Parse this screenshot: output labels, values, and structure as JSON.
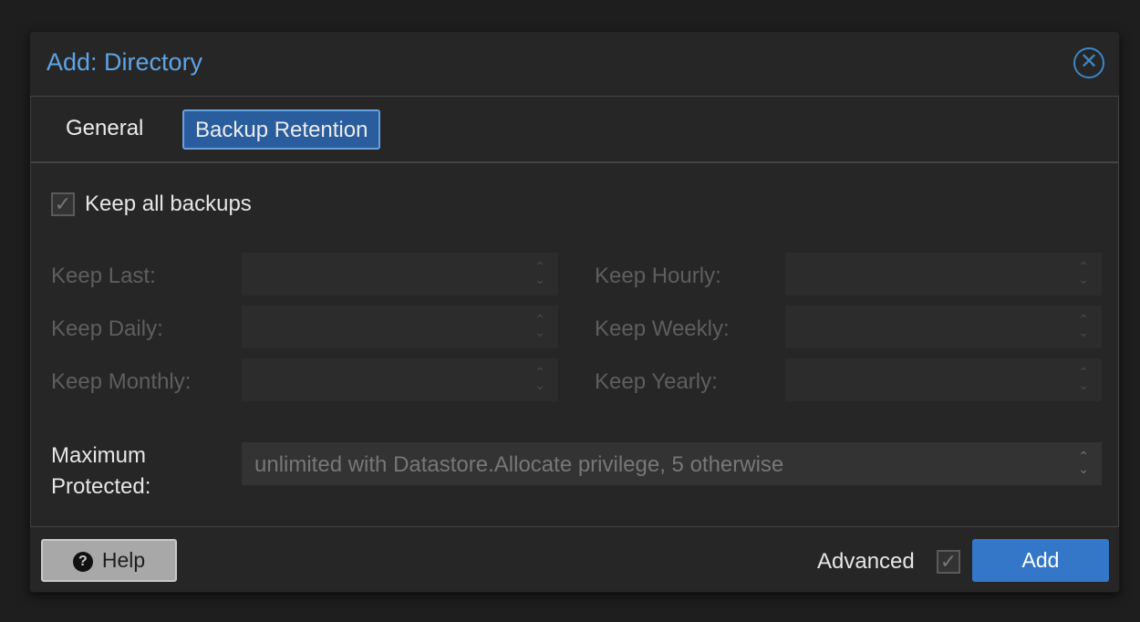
{
  "dialog": {
    "title": "Add: Directory",
    "close_icon": "close-circle-icon"
  },
  "tabs": [
    {
      "label": "General"
    },
    {
      "label": "Backup Retention",
      "active": true
    }
  ],
  "keep_all": {
    "label": "Keep all backups",
    "checked": true
  },
  "fields": {
    "keep_last": {
      "label": "Keep Last:",
      "value": ""
    },
    "keep_hourly": {
      "label": "Keep Hourly:",
      "value": ""
    },
    "keep_daily": {
      "label": "Keep Daily:",
      "value": ""
    },
    "keep_weekly": {
      "label": "Keep Weekly:",
      "value": ""
    },
    "keep_monthly": {
      "label": "Keep Monthly:",
      "value": ""
    },
    "keep_yearly": {
      "label": "Keep Yearly:",
      "value": ""
    },
    "max_protected": {
      "label1": "Maximum",
      "label2": "Protected:",
      "placeholder": "unlimited with Datastore.Allocate privilege, 5 otherwise"
    }
  },
  "footer": {
    "help": "Help",
    "advanced": "Advanced",
    "advanced_checked": true,
    "add": "Add"
  },
  "colors": {
    "accent": "#5ea4e6",
    "active_tab": "#2a5d9e",
    "add_button": "#3477c9"
  }
}
